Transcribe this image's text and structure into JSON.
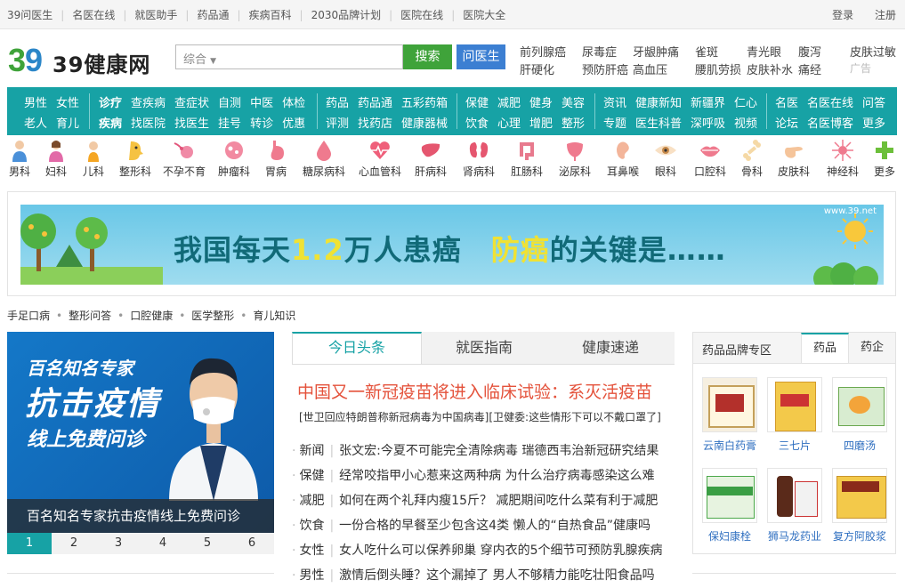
{
  "topbar": {
    "links": [
      "39问医生",
      "名医在线",
      "就医助手",
      "药品通",
      "疾病百科",
      "2030品牌计划",
      "医院在线",
      "医院大全"
    ],
    "login": "登录",
    "register": "注册"
  },
  "logo": {
    "text": "39健康网"
  },
  "search": {
    "scope": "综合",
    "button": "搜索",
    "ask_button": "问医生"
  },
  "hotlinks": {
    "row1": [
      "前列腺癌",
      "尿毒症",
      "牙龈肿痛",
      "雀斑",
      "青光眼",
      "腹泻",
      "皮肤过敏"
    ],
    "row2": [
      "肝硬化",
      "预防肝癌",
      "高血压",
      "腰肌劳损",
      "皮肤补水",
      "痛经",
      "广告"
    ]
  },
  "nav": {
    "groups": [
      {
        "row1": [
          "男性",
          "女性"
        ],
        "row2": [
          "老人",
          "育儿"
        ]
      },
      {
        "row1": [
          "诊疗",
          "查疾病",
          "查症状",
          "自测",
          "中医",
          "体检"
        ],
        "row2": [
          "疾病",
          "找医院",
          "找医生",
          "挂号",
          "转诊",
          "优惠"
        ]
      },
      {
        "row1": [
          "药品",
          "药品通",
          "五彩药箱"
        ],
        "row2": [
          "评测",
          "找药店",
          "健康器械"
        ]
      },
      {
        "row1": [
          "保健",
          "减肥",
          "健身",
          "美容"
        ],
        "row2": [
          "饮食",
          "心理",
          "增肥",
          "整形"
        ]
      },
      {
        "row1": [
          "资讯",
          "健康新知",
          "新疆界",
          "仁心"
        ],
        "row2": [
          "专题",
          "医生科普",
          "深呼吸",
          "视频"
        ]
      },
      {
        "row1": [
          "名医",
          "名医在线",
          "问答"
        ],
        "row2": [
          "论坛",
          "名医博客",
          "更多"
        ]
      }
    ]
  },
  "departments": [
    "男科",
    "妇科",
    "儿科",
    "整形科",
    "不孕不育",
    "肿瘤科",
    "胃病",
    "糖尿病科",
    "心血管科",
    "肝病科",
    "肾病科",
    "肛肠科",
    "泌尿科",
    "耳鼻喉",
    "眼科",
    "口腔科",
    "骨科",
    "皮肤科",
    "神经科",
    "更多"
  ],
  "banner": {
    "part1": "我国每天",
    "num": "1.2",
    "part2": "万人患癌",
    "part3": "防癌",
    "part4": "的关键是……",
    "site": "www.39.net"
  },
  "tags": [
    "手足口病",
    "整形问答",
    "口腔健康",
    "医学整形",
    "育儿知识"
  ],
  "promo": {
    "line1": "百名知名专家",
    "line2": "抗击疫情",
    "line3": "线上免费问诊",
    "caption": "百名知名专家抗击疫情线上免费问诊"
  },
  "pager": [
    "1",
    "2",
    "3",
    "4",
    "5",
    "6"
  ],
  "news_tabs": [
    "今日头条",
    "就医指南",
    "健康速递"
  ],
  "headline": "中国又一新冠疫苗将进入临床试验：系灭活疫苗",
  "subline": "[世卫回应特朗普称新冠病毒为中国病毒][卫健委:这些情形下可以不戴口罩了]",
  "news": [
    {
      "cat": "新闻",
      "title": "张文宏:今夏不可能完全清除病毒  瑞德西韦治新冠研究结果"
    },
    {
      "cat": "保健",
      "title": "经常咬指甲小心惹来这两种病  为什么治疗病毒感染这么难"
    },
    {
      "cat": "减肥",
      "title": "如何在两个礼拜内瘦15斤？  减肥期间吃什么菜有利于减肥"
    },
    {
      "cat": "饮食",
      "title": "一份合格的早餐至少包含这4类  懒人的“自热食品”健康吗"
    },
    {
      "cat": "女性",
      "title": "女人吃什么可以保养卵巢  穿内衣的5个细节可预防乳腺疾病"
    },
    {
      "cat": "男性",
      "title": "激情后倒头睡？这个漏掉了  男人不够精力能吃壮阳食品吗"
    }
  ],
  "drug_panel": {
    "title": "药品品牌专区",
    "tabs": [
      "药品",
      "药企"
    ],
    "items": [
      "云南白药膏",
      "三七片",
      "四磨汤",
      "保妇康栓",
      "狮马龙药业",
      "复方阿胶浆"
    ]
  },
  "colors": {
    "brand": "#17a2a5",
    "search_green": "#3fa33a",
    "ask_blue": "#3c7fd2",
    "headline_red": "#e4523b"
  }
}
